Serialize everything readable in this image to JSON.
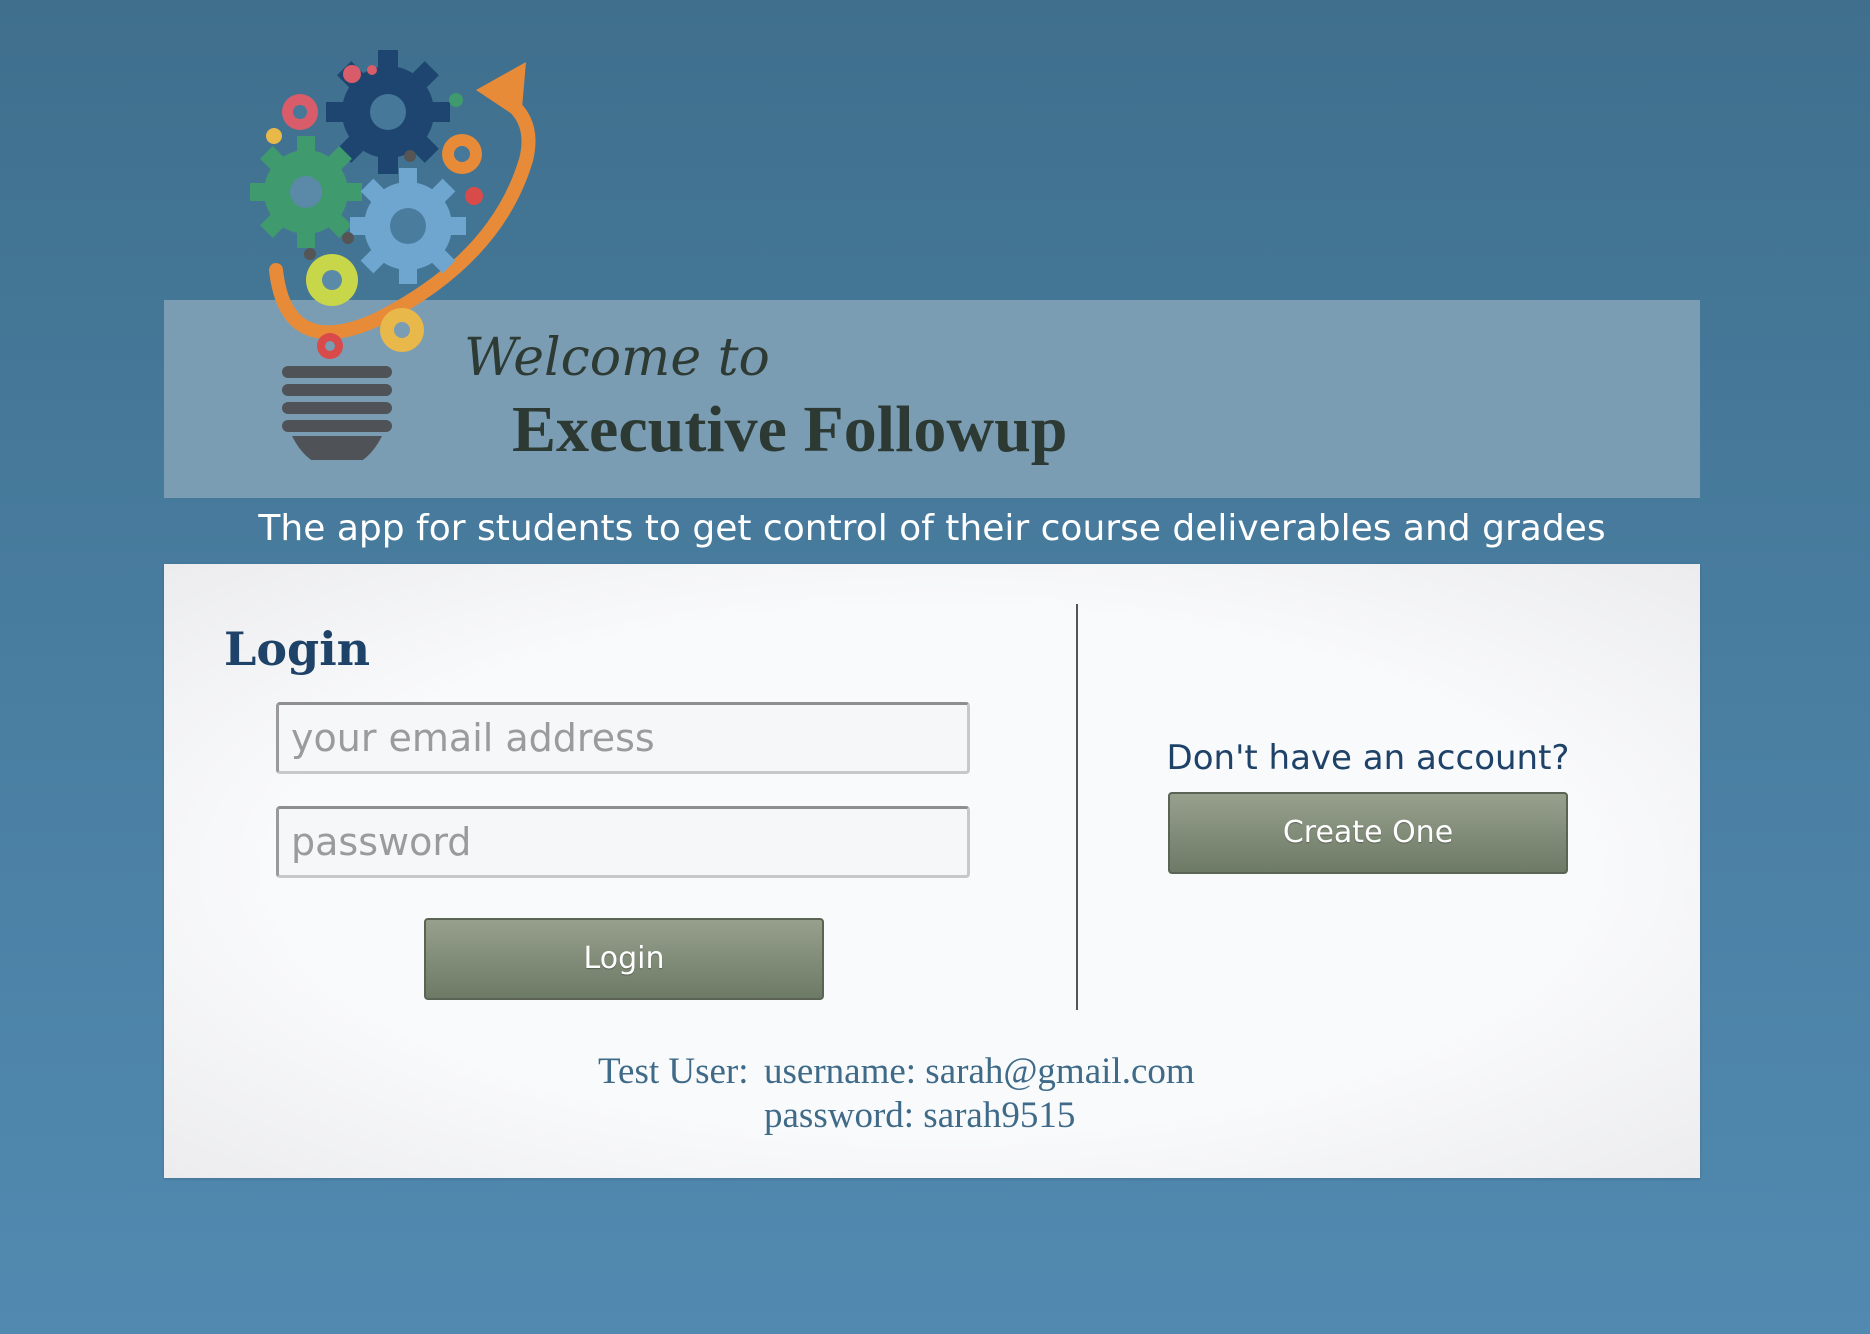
{
  "header": {
    "welcome": "Welcome to",
    "app_title": "Executive Followup",
    "tagline": "The app for students to get control of their course deliverables and grades"
  },
  "login": {
    "heading": "Login",
    "email_placeholder": "your email address",
    "password_placeholder": "password",
    "button_label": "Login"
  },
  "signup": {
    "prompt": "Don't have an account?",
    "button_label": "Create One"
  },
  "test_user": {
    "label": "Test User:",
    "username": "username: sarah@gmail.com",
    "password": "password: sarah9515"
  },
  "logo": {
    "icon": "lightbulb-gears-logo"
  },
  "colors": {
    "background": "#467a9c",
    "banner": "#7b9db4",
    "heading": "#1f4268",
    "button": "#7d8874"
  }
}
